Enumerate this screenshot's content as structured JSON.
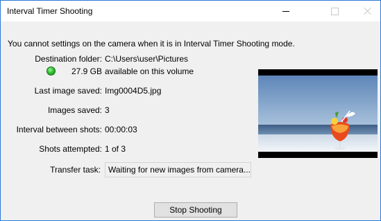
{
  "window": {
    "title": "Interval Timer Shooting"
  },
  "notice": "You cannot settings on the camera when it is in Interval Timer Shooting mode.",
  "fields": {
    "destination_label": "Destination folder:",
    "destination_value": "C:\\Users\\user\\Pictures",
    "free_space_value": "27.9 GB",
    "free_space_suffix": "available on this volume",
    "last_image_label": "Last image saved:",
    "last_image_value": "Img0004D5.jpg",
    "images_saved_label": "Images saved:",
    "images_saved_value": "3",
    "interval_label": "Interval between shots:",
    "interval_value": "00:00:03",
    "shots_attempted_label": "Shots attempted:",
    "shots_attempted_value": "1 of 3",
    "transfer_label": "Transfer task:",
    "transfer_value": "Waiting for new images from camera..."
  },
  "buttons": {
    "stop_shooting": "Stop Shooting"
  },
  "colors": {
    "window_border": "#2b79d4",
    "status_ok": "#2fc22f",
    "dialog_background": "#f0f0f0"
  }
}
